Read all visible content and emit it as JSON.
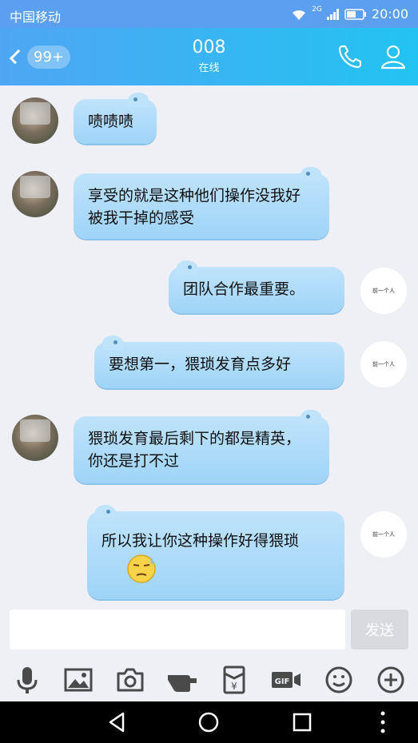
{
  "status": {
    "carrier": "中国移动",
    "network": "2G",
    "time": "20:00"
  },
  "header": {
    "badge": "99+",
    "title": "008",
    "subtitle": "在线"
  },
  "messages": [
    {
      "side": "left",
      "text": "啧啧啧"
    },
    {
      "side": "left",
      "text": "享受的就是这种他们操作没我好被我干掉的感受"
    },
    {
      "side": "right",
      "text": "团队合作最重要。"
    },
    {
      "side": "right",
      "text": "要想第一，猥琐发育点多好"
    },
    {
      "side": "left",
      "text": "猥琐发育最后剩下的都是精英，你还是打不过"
    },
    {
      "side": "right",
      "text": "所以我让你这种操作好得猥琐",
      "emoji": "sweat-smirk-emoji"
    }
  ],
  "avatar_right_text": "前一个人",
  "composer": {
    "value": "",
    "send_label": "发送"
  },
  "toolbar": [
    "microphone-icon",
    "image-icon",
    "camera-icon",
    "poke-icon",
    "red-packet-icon",
    "gif-icon",
    "emoji-icon",
    "plus-icon"
  ],
  "colors": {
    "header_start": "#4fa6f3",
    "header_end": "#22c3f2",
    "bubble": "#a9daf9"
  }
}
